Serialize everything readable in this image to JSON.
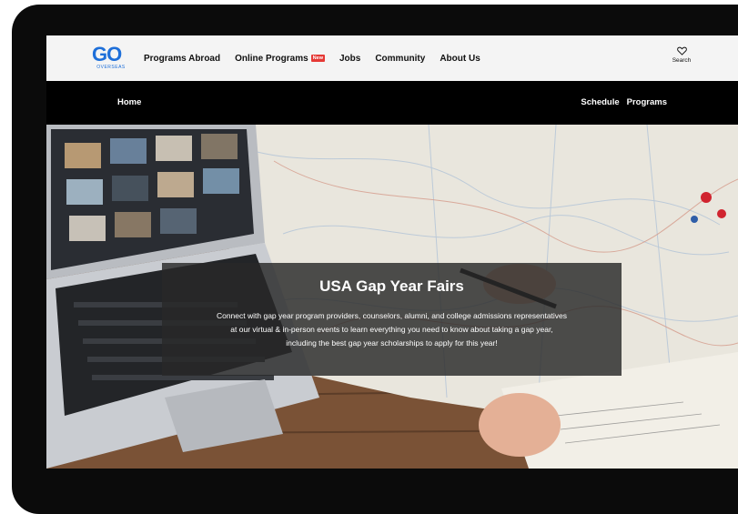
{
  "logo": {
    "text": "GO",
    "sub": "OVERSEAS"
  },
  "topnav": {
    "items": [
      {
        "label": "Programs Abroad"
      },
      {
        "label": "Online Programs",
        "badge": "New"
      },
      {
        "label": "Jobs"
      },
      {
        "label": "Community"
      },
      {
        "label": "About Us"
      }
    ],
    "favorites_label": "Search"
  },
  "subnav": {
    "home": "Home",
    "right": [
      {
        "label": "Schedule"
      },
      {
        "label": "Programs"
      }
    ]
  },
  "hero": {
    "title": "USA Gap Year Fairs",
    "line1": "Connect with gap year program providers, counselors, alumni, and college admissions representatives",
    "line2": "at our virtual & in-person events to learn everything you need to know about taking a gap year,",
    "line3": "including the best gap year scholarships to apply for this year!"
  },
  "colors": {
    "brand": "#1e6fd9",
    "badge": "#e53935",
    "overlay": "#282828"
  }
}
